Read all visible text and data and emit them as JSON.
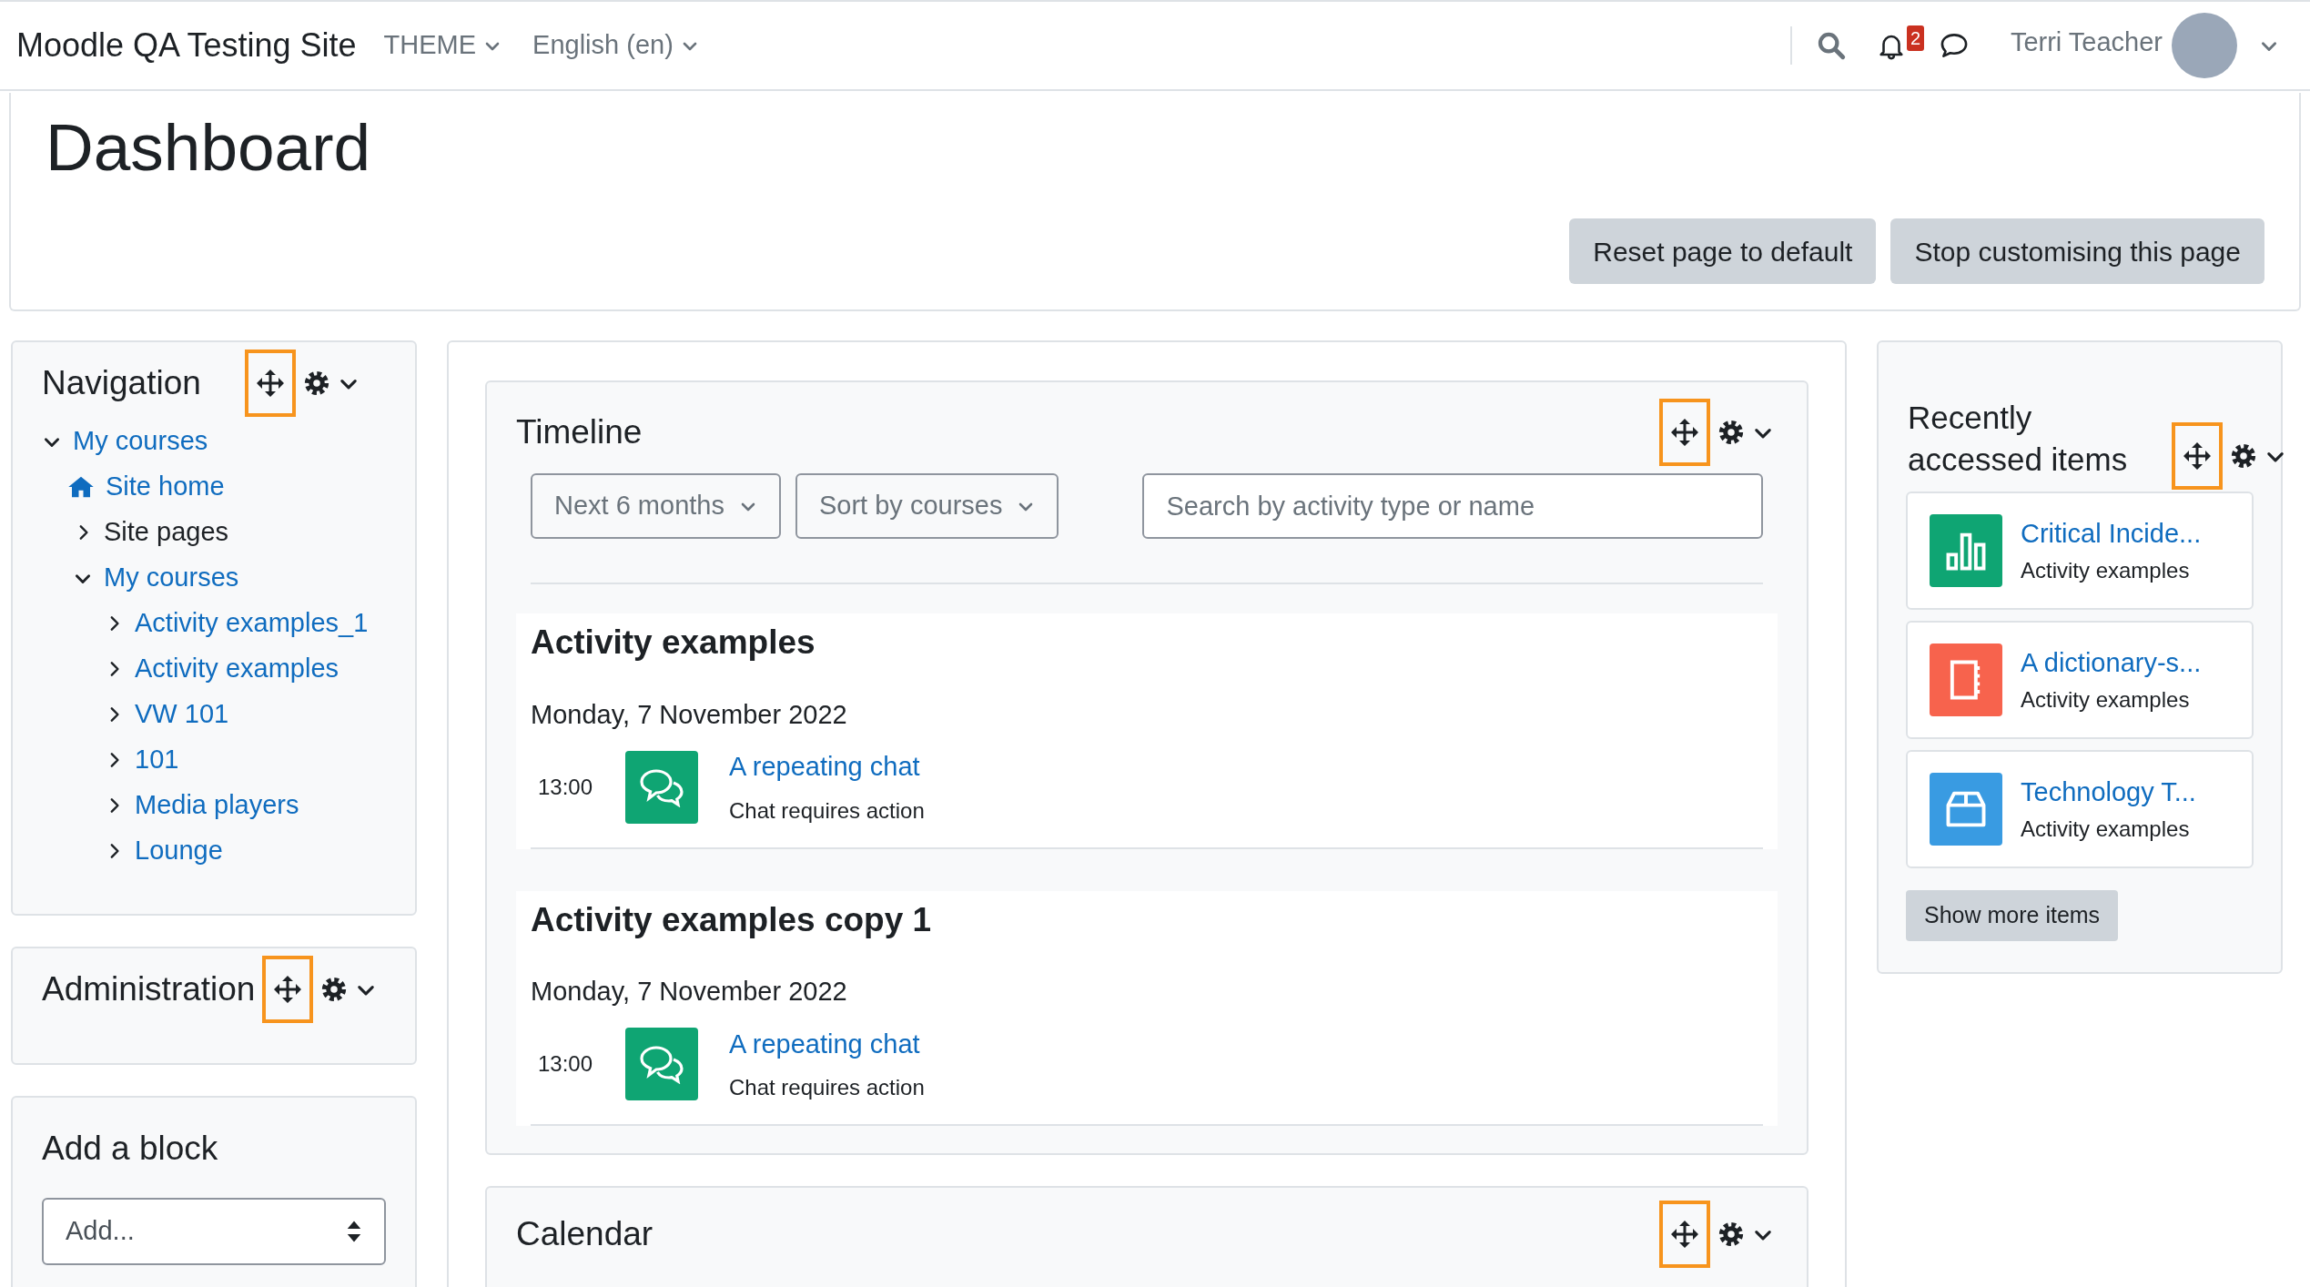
{
  "navbar": {
    "site_name": "Moodle QA Testing Site",
    "menus": [
      "THEME",
      "English (en)"
    ],
    "notification_count": "2",
    "user_name": "Terri Teacher"
  },
  "header": {
    "title": "Dashboard",
    "buttons": [
      "Reset page to default",
      "Stop customising this page"
    ]
  },
  "left_blocks": [
    {
      "kind": "navigation",
      "title": "Navigation",
      "move_highlighted": true,
      "tree": [
        {
          "label": "My courses",
          "kind": "branch",
          "link": true,
          "expanded": true,
          "children": [
            {
              "label": "Site home",
              "kind": "home",
              "link": true
            },
            {
              "label": "Site pages",
              "kind": "branch",
              "link": false,
              "expanded": false
            },
            {
              "label": "My courses",
              "kind": "branch",
              "link": true,
              "expanded": true,
              "children": [
                {
                  "label": "Activity examples_1",
                  "kind": "branch",
                  "link": true,
                  "expanded": false
                },
                {
                  "label": "Activity examples",
                  "kind": "branch",
                  "link": true,
                  "expanded": false
                },
                {
                  "label": "VW 101",
                  "kind": "branch",
                  "link": true,
                  "expanded": false
                },
                {
                  "label": "101",
                  "kind": "branch",
                  "link": true,
                  "expanded": false
                },
                {
                  "label": "Media players",
                  "kind": "branch",
                  "link": true,
                  "expanded": false
                },
                {
                  "label": "Lounge",
                  "kind": "branch",
                  "link": true,
                  "expanded": false
                }
              ]
            }
          ]
        }
      ]
    },
    {
      "kind": "administration",
      "title": "Administration",
      "move_highlighted": true
    },
    {
      "kind": "add_block",
      "title": "Add a block",
      "select_value": "Add..."
    }
  ],
  "timeline": {
    "title": "Timeline",
    "move_highlighted": true,
    "filters": [
      "Next 6 months",
      "Sort by courses"
    ],
    "search": {
      "placeholder": "Search by activity type or name"
    },
    "groups": [
      {
        "course": "Activity examples",
        "date": "Monday, 7 November 2022",
        "events": [
          {
            "time": "13:00",
            "name": "A repeating chat",
            "action": "Chat requires action"
          }
        ]
      },
      {
        "course": "Activity examples copy 1",
        "date": "Monday, 7 November 2022",
        "events": [
          {
            "time": "13:00",
            "name": "A repeating chat",
            "action": "Chat requires action"
          }
        ]
      }
    ]
  },
  "calendar": {
    "title": "Calendar",
    "move_highlighted": true
  },
  "recent": {
    "title": "Recently accessed items",
    "move_highlighted": true,
    "items": [
      {
        "name": "Critical Incide...",
        "course": "Activity examples",
        "kind": "chart",
        "color": "#0fa573"
      },
      {
        "name": "A dictionary-s...",
        "course": "Activity examples",
        "kind": "book",
        "color": "#f7634d"
      },
      {
        "name": "Technology T...",
        "course": "Activity examples",
        "kind": "box",
        "color": "#399be2"
      }
    ],
    "more_button": "Show more items"
  }
}
